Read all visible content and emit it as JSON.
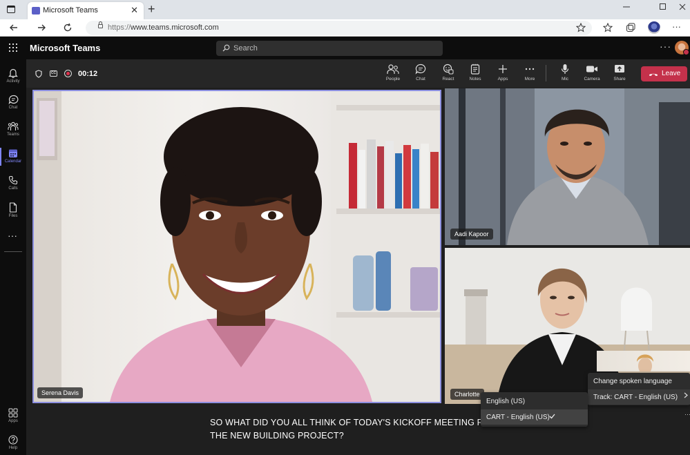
{
  "browser": {
    "tab_title": "Microsoft Teams",
    "tab_close": "✕",
    "new_tab": "+",
    "url_scheme": "https://",
    "url_host": "www.teams.microsoft.com",
    "more": "···"
  },
  "header": {
    "app_title": "Microsoft Teams",
    "search_placeholder": "Search",
    "more": "···"
  },
  "rail": {
    "items": [
      {
        "label": "Activity",
        "icon": "bell-icon"
      },
      {
        "label": "Chat",
        "icon": "chat-icon"
      },
      {
        "label": "Teams",
        "icon": "teams-icon"
      },
      {
        "label": "Calendar",
        "icon": "calendar-icon",
        "active": true
      },
      {
        "label": "Calls",
        "icon": "phone-icon"
      },
      {
        "label": "Files",
        "icon": "file-icon"
      }
    ],
    "more": "···",
    "bottom": [
      {
        "label": "Apps",
        "icon": "apps-icon"
      },
      {
        "label": "Help",
        "icon": "help-icon"
      }
    ]
  },
  "meeting": {
    "timer": "00:12",
    "cc_label": "CC",
    "toolbar": [
      {
        "label": "People",
        "icon": "people-icon"
      },
      {
        "label": "Chat",
        "icon": "chat-icon"
      },
      {
        "label": "React",
        "icon": "react-icon"
      },
      {
        "label": "Notes",
        "icon": "notes-icon"
      },
      {
        "label": "Apps",
        "icon": "plus-icon"
      },
      {
        "label": "More",
        "icon": "more-icon"
      },
      {
        "label": "Mic",
        "icon": "mic-icon"
      },
      {
        "label": "Camera",
        "icon": "camera-icon"
      },
      {
        "label": "Share",
        "icon": "share-icon"
      }
    ],
    "leave_label": "Leave",
    "accent": "#c4314b"
  },
  "participants": [
    {
      "name": "Serena Davis"
    },
    {
      "name": "Aadi Kapoor"
    },
    {
      "name": "Charlotte"
    }
  ],
  "caption": {
    "line1": "SO WHAT DID YOU ALL THINK OF TODAY'S KICKOFF MEETING FOR",
    "line2": "THE NEW BUILDING PROJECT?"
  },
  "caption_menu": {
    "items": [
      {
        "label": "Change spoken language"
      },
      {
        "label": "Track: CART - English (US)"
      }
    ]
  },
  "language_menu": {
    "items": [
      {
        "label": "English (US)"
      },
      {
        "label": "CART - English (US)",
        "selected": true
      }
    ]
  },
  "stage_more": "···"
}
